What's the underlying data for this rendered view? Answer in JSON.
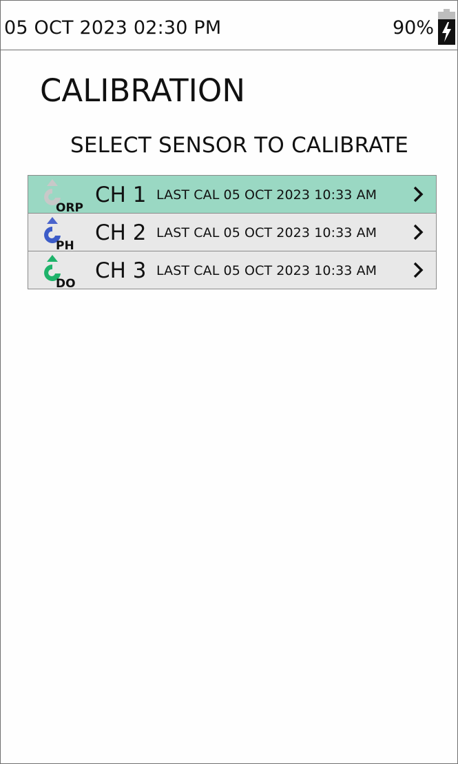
{
  "status_bar": {
    "datetime": "05 OCT 2023 02:30 PM",
    "battery_percent": "90%",
    "battery_icon": "battery-charging-icon"
  },
  "page": {
    "title": "CALIBRATION",
    "subtitle": "SELECT SENSOR TO CALIBRATE"
  },
  "sensors": [
    {
      "channel": "CH 1",
      "sensor_type": "ORP",
      "icon": "orp-sensor-icon",
      "icon_color": "#b5b5b5",
      "last_cal": "LAST CAL 05 OCT 2023 10:33 AM",
      "selected": true
    },
    {
      "channel": "CH 2",
      "sensor_type": "PH",
      "icon": "ph-sensor-icon",
      "icon_color": "#3c5cc8",
      "last_cal": "LAST CAL 05 OCT 2023 10:33 AM",
      "selected": false
    },
    {
      "channel": "CH 3",
      "sensor_type": "DO",
      "icon": "do-sensor-icon",
      "icon_color": "#1fb36b",
      "last_cal": "LAST CAL 05 OCT 2023 10:33 AM",
      "selected": false
    }
  ],
  "colors": {
    "selected_row": "#9ad8c3",
    "row": "#e8e8e8",
    "border": "#8a8a8a"
  }
}
